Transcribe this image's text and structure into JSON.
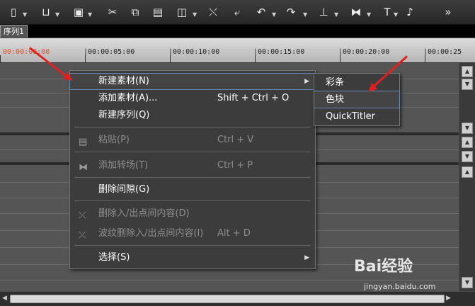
{
  "toolbar": {
    "icons": [
      "new-file-icon",
      "open-icon",
      "save-icon",
      "cut-icon",
      "copy-icon",
      "paste-icon",
      "group-icon",
      "split-icon",
      "undo-icon",
      "redo-icon",
      "trim-icon",
      "transition-icon",
      "text-icon",
      "mic-icon",
      "more-icon"
    ]
  },
  "tabs": {
    "sequence_tab": "序列1"
  },
  "ruler": {
    "marks": [
      "00:00:00:00",
      "|00:00:05:00",
      "|00:00:10:00",
      "|00:00:15:00",
      "|00:00:20:00",
      "|00:00:25"
    ]
  },
  "context_menu": {
    "new_material": "新建素材(N)",
    "add_material": "添加素材(A)...",
    "add_material_shortcut": "Shift + Ctrl + O",
    "new_sequence": "新建序列(Q)",
    "paste": "粘贴(P)",
    "paste_shortcut": "Ctrl + V",
    "add_transition": "添加转场(T)",
    "add_transition_shortcut": "Ctrl + P",
    "delete_gap": "删除间隙(G)",
    "delete_in_out": "删除入/出点间内容(D)",
    "ripple_delete": "波纹删除入/出点间内容(I)",
    "ripple_delete_shortcut": "Alt + D",
    "select": "选择(S)"
  },
  "submenu": {
    "color_bars": "彩条",
    "color_block": "色块",
    "quicktitler": "QuickTitler"
  },
  "watermark": {
    "brand": "Bai经验",
    "url": "jingyan.baidu.com"
  },
  "colors": {
    "arrow": "#e02020",
    "highlight_border": "#6a86b3",
    "timecode_first": "#e0522b"
  }
}
